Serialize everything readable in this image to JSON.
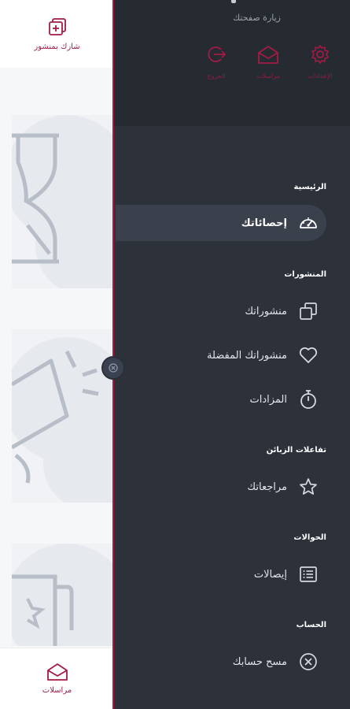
{
  "background_app": {
    "share_post_label": "شارك بمنشور",
    "bottom_nav_label": "مراسلات"
  },
  "drawer": {
    "header": {
      "visit_label": "زيارة صفحتك",
      "actions": [
        {
          "icon": "settings-icon",
          "label": "الإعدادات"
        },
        {
          "icon": "mail-open-icon",
          "label": "مراسلات"
        },
        {
          "icon": "logout-icon",
          "label": "الخروج"
        }
      ]
    },
    "sections": [
      {
        "title": "الرئيسية",
        "items": [
          {
            "label": "إحصائاتك",
            "icon": "dashboard-gauge-icon",
            "active": true
          }
        ]
      },
      {
        "title": "المنشورات",
        "items": [
          {
            "label": "منشوراتك",
            "icon": "copy-posts-icon"
          },
          {
            "label": "منشوراتك المفضلة",
            "icon": "heart-icon"
          },
          {
            "label": "المزادات",
            "icon": "stopwatch-icon"
          }
        ]
      },
      {
        "title": "تفاعلات الزبائن",
        "items": [
          {
            "label": "مراجعاتك",
            "icon": "star-icon"
          }
        ]
      },
      {
        "title": "الحوالات",
        "items": [
          {
            "label": "إيصالات",
            "icon": "receipt-list-icon"
          }
        ]
      },
      {
        "title": "الحساب",
        "items": [
          {
            "label": "مسح حسابك",
            "icon": "delete-circle-icon"
          }
        ]
      }
    ]
  },
  "colors": {
    "accent": "#a31b45",
    "drawer_bg": "#2c313a",
    "header_bg": "#262a31",
    "active_bg": "#3b414c"
  }
}
